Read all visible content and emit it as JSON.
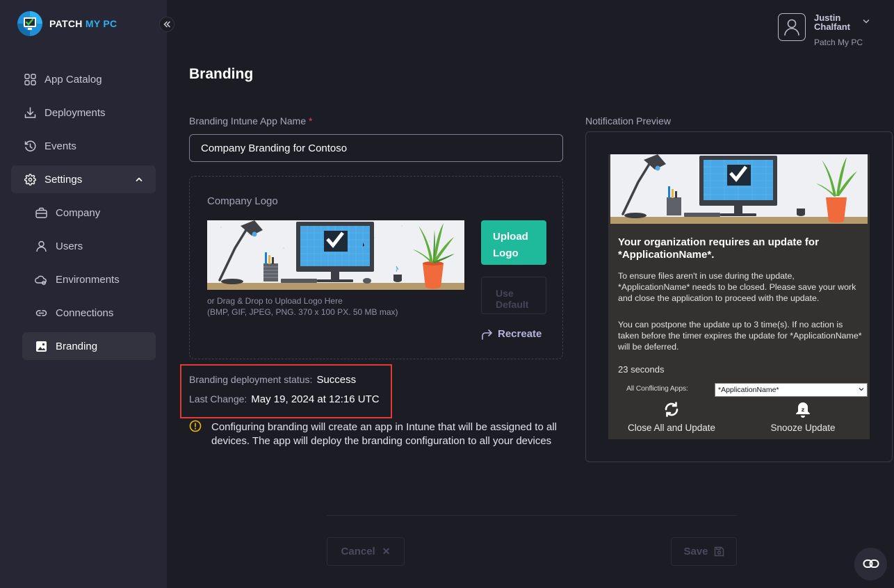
{
  "brand": {
    "name_primary": "PATCH",
    "name_accent": "MY PC"
  },
  "sidebar": {
    "items": [
      {
        "label": "App Catalog",
        "icon": "grid-icon"
      },
      {
        "label": "Deployments",
        "icon": "download-icon"
      },
      {
        "label": "Events",
        "icon": "history-icon"
      },
      {
        "label": "Settings",
        "icon": "gear-icon",
        "expanded": true
      }
    ],
    "settings_items": [
      {
        "label": "Company",
        "icon": "briefcase-icon"
      },
      {
        "label": "Users",
        "icon": "user-icon"
      },
      {
        "label": "Environments",
        "icon": "cloud-icon"
      },
      {
        "label": "Connections",
        "icon": "link-icon"
      },
      {
        "label": "Branding",
        "icon": "image-icon",
        "active": true
      }
    ]
  },
  "user": {
    "name": "Justin Chalfant",
    "org": "Patch My PC"
  },
  "page": {
    "title": "Branding"
  },
  "form": {
    "app_name_label": "Branding Intune App Name",
    "required_mark": "*",
    "app_name_value": "Company Branding for Contoso",
    "logo_label": "Company Logo",
    "drag_hint_line1": "or Drag & Drop to Upload Logo Here",
    "drag_hint_line2": "(BMP, GIF, JPEG, PNG. 370 x 100 PX. 50 MB max)",
    "upload_line1": "Upload",
    "upload_line2": "Logo",
    "default_line1": "Use",
    "default_line2": "Default",
    "recreate_label": "Recreate"
  },
  "status": {
    "deployment_label": "Branding deployment status:",
    "deployment_value": "Success",
    "last_change_label": "Last Change:",
    "last_change_value": "May 19, 2024 at 12:16 UTC"
  },
  "info": {
    "text": "Configuring branding will create an app in Intune that will be assigned to all devices. The app will deploy the branding configuration to all your devices"
  },
  "footer": {
    "cancel_label": "Cancel",
    "save_label": "Save"
  },
  "preview": {
    "label": "Notification Preview",
    "title": "Your organization requires an update for *ApplicationName*.",
    "para1": "To ensure files aren't in use during the update, *ApplicationName* needs to be closed. Please save your work and close the application to proceed with the update.",
    "para2": "You can postpone the update up to 3 time(s). If no action is taken before the timer expires the update for *ApplicationName* will be deferred.",
    "timer": "23 seconds",
    "conflicting_label": "All Conflicting Apps:",
    "conflicting_value": "*ApplicationName*",
    "close_all_label": "Close All and Update",
    "snooze_label": "Snooze Update"
  },
  "colors": {
    "accent": "#1fb99c",
    "highlight": "#e53935",
    "brand_blue": "#2db0f0"
  }
}
